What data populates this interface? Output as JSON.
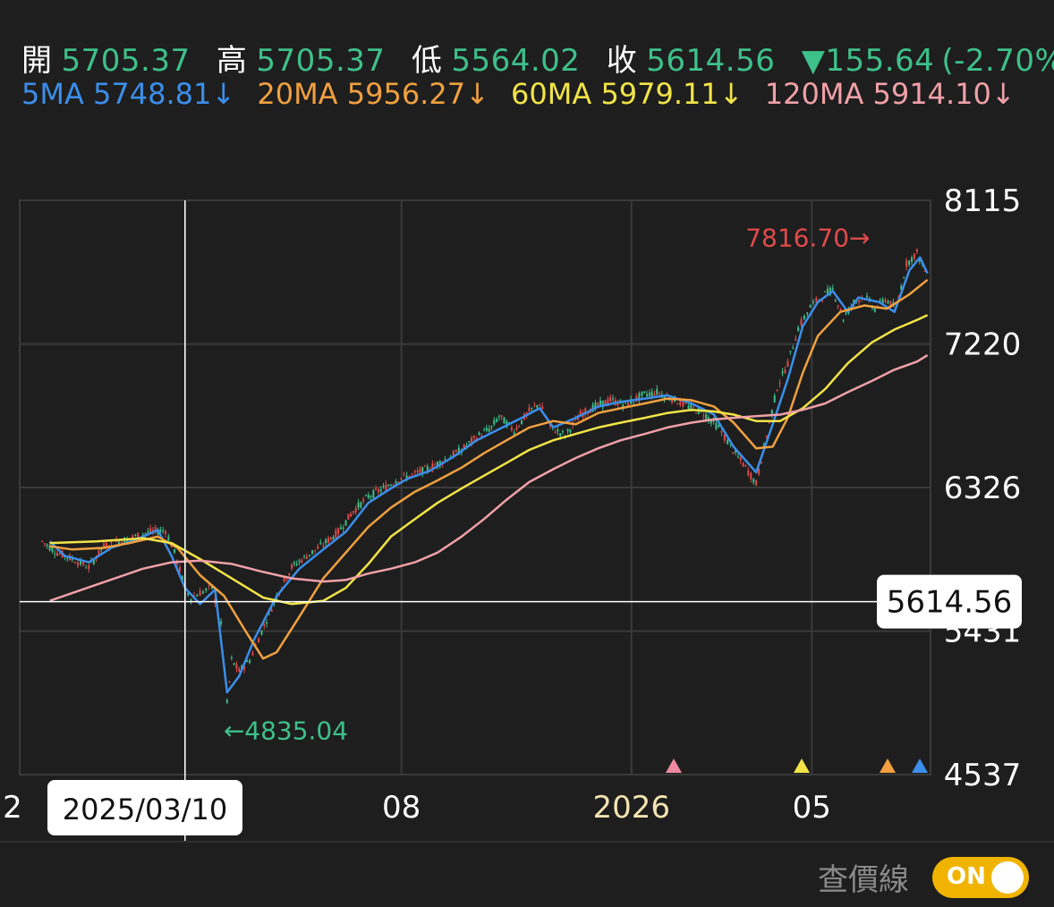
{
  "header": {
    "open_label": "開",
    "open": "5705.37",
    "high_label": "高",
    "high": "5705.37",
    "low_label": "低",
    "low": "5564.02",
    "close_label": "收",
    "close": "5614.56",
    "change": "▼155.64",
    "change_pct": "(-2.70%)"
  },
  "ma_legend": [
    {
      "text": "5MA 5748.81↓",
      "color": "#3b8eea"
    },
    {
      "text": "20MA 5956.27↓",
      "color": "#f0a040"
    },
    {
      "text": "60MA 5979.11↓",
      "color": "#f2e447"
    },
    {
      "text": "120MA 5914.10↓",
      "color": "#f0a0a8"
    }
  ],
  "toggle": {
    "label": "查價線",
    "state": "ON"
  },
  "colors": {
    "up": "#e04a4a",
    "down": "#3ec08a",
    "grid": "#3a3a3a",
    "ma5": "#3b8eea",
    "ma20": "#f0a040",
    "ma60": "#f2e447",
    "ma120": "#f0a0a8",
    "accent": "#f0b400"
  },
  "chart_data": {
    "type": "line",
    "y_ticks": [
      "8115",
      "7220",
      "6326",
      "5431",
      "4537"
    ],
    "ylim": [
      4537,
      8115
    ],
    "x_ticks": [
      {
        "label": "2",
        "date": "2024-12"
      },
      {
        "label": "2025/03/10",
        "date": "2025-03-10"
      },
      {
        "label": "08",
        "date": "2025-08"
      },
      {
        "label": "2026",
        "date": "2026-01"
      },
      {
        "label": "05",
        "date": "2026-05"
      }
    ],
    "crosshair": {
      "date": "2025/03/10",
      "price": "5614.56"
    },
    "annotations": [
      {
        "text": "7816.70",
        "kind": "high",
        "date": "2026-06-10",
        "value": 7816.7
      },
      {
        "text": "4835.04",
        "kind": "low",
        "date": "2025-04-07",
        "value": 4835.04
      }
    ],
    "series": [
      {
        "name": "5MA",
        "key": "ma5",
        "points": [
          [
            "2024-12-10",
            5990
          ],
          [
            "2024-12-20",
            5900
          ],
          [
            "2025-01-05",
            5860
          ],
          [
            "2025-01-20",
            5950
          ],
          [
            "2025-02-05",
            6000
          ],
          [
            "2025-02-20",
            6060
          ],
          [
            "2025-03-01",
            5900
          ],
          [
            "2025-03-10",
            5700
          ],
          [
            "2025-03-20",
            5600
          ],
          [
            "2025-03-30",
            5690
          ],
          [
            "2025-04-07",
            5050
          ],
          [
            "2025-04-15",
            5150
          ],
          [
            "2025-04-25",
            5380
          ],
          [
            "2025-05-10",
            5650
          ],
          [
            "2025-05-25",
            5820
          ],
          [
            "2025-06-10",
            5940
          ],
          [
            "2025-06-25",
            6050
          ],
          [
            "2025-07-10",
            6230
          ],
          [
            "2025-07-25",
            6320
          ],
          [
            "2025-08-05",
            6380
          ],
          [
            "2025-08-20",
            6430
          ],
          [
            "2025-09-05",
            6520
          ],
          [
            "2025-09-20",
            6620
          ],
          [
            "2025-10-05",
            6690
          ],
          [
            "2025-10-20",
            6760
          ],
          [
            "2025-11-01",
            6820
          ],
          [
            "2025-11-10",
            6700
          ],
          [
            "2025-11-25",
            6760
          ],
          [
            "2025-12-10",
            6830
          ],
          [
            "2025-12-25",
            6860
          ],
          [
            "2026-01-10",
            6880
          ],
          [
            "2026-01-25",
            6900
          ],
          [
            "2026-02-10",
            6850
          ],
          [
            "2026-02-25",
            6780
          ],
          [
            "2026-03-10",
            6580
          ],
          [
            "2026-03-25",
            6420
          ],
          [
            "2026-04-05",
            6720
          ],
          [
            "2026-04-15",
            7000
          ],
          [
            "2026-04-25",
            7330
          ],
          [
            "2026-05-05",
            7480
          ],
          [
            "2026-05-15",
            7550
          ],
          [
            "2026-05-25",
            7420
          ],
          [
            "2026-06-01",
            7510
          ],
          [
            "2026-06-15",
            7480
          ],
          [
            "2026-06-25",
            7420
          ],
          [
            "2026-07-05",
            7680
          ],
          [
            "2026-07-12",
            7760
          ],
          [
            "2026-07-17",
            7660
          ]
        ]
      },
      {
        "name": "20MA",
        "key": "ma20",
        "points": [
          [
            "2024-12-10",
            5960
          ],
          [
            "2024-12-25",
            5940
          ],
          [
            "2025-01-15",
            5950
          ],
          [
            "2025-02-01",
            5980
          ],
          [
            "2025-02-20",
            6020
          ],
          [
            "2025-03-05",
            5950
          ],
          [
            "2025-03-20",
            5780
          ],
          [
            "2025-04-05",
            5650
          ],
          [
            "2025-04-20",
            5420
          ],
          [
            "2025-05-01",
            5260
          ],
          [
            "2025-05-10",
            5300
          ],
          [
            "2025-05-25",
            5520
          ],
          [
            "2025-06-10",
            5760
          ],
          [
            "2025-06-25",
            5920
          ],
          [
            "2025-07-10",
            6080
          ],
          [
            "2025-07-25",
            6200
          ],
          [
            "2025-08-10",
            6300
          ],
          [
            "2025-08-25",
            6370
          ],
          [
            "2025-09-10",
            6450
          ],
          [
            "2025-09-25",
            6540
          ],
          [
            "2025-10-10",
            6620
          ],
          [
            "2025-10-25",
            6700
          ],
          [
            "2025-11-10",
            6740
          ],
          [
            "2025-11-25",
            6720
          ],
          [
            "2025-12-10",
            6790
          ],
          [
            "2025-12-25",
            6820
          ],
          [
            "2026-01-10",
            6850
          ],
          [
            "2026-01-25",
            6880
          ],
          [
            "2026-02-10",
            6870
          ],
          [
            "2026-02-25",
            6830
          ],
          [
            "2026-03-10",
            6730
          ],
          [
            "2026-03-25",
            6570
          ],
          [
            "2026-04-05",
            6580
          ],
          [
            "2026-04-15",
            6760
          ],
          [
            "2026-04-25",
            7040
          ],
          [
            "2026-05-05",
            7270
          ],
          [
            "2026-05-20",
            7420
          ],
          [
            "2026-06-05",
            7460
          ],
          [
            "2026-06-20",
            7440
          ],
          [
            "2026-07-05",
            7530
          ],
          [
            "2026-07-17",
            7620
          ]
        ]
      },
      {
        "name": "60MA",
        "key": "ma60",
        "points": [
          [
            "2024-12-10",
            5980
          ],
          [
            "2025-01-10",
            5990
          ],
          [
            "2025-02-10",
            6010
          ],
          [
            "2025-03-01",
            5980
          ],
          [
            "2025-03-20",
            5880
          ],
          [
            "2025-04-10",
            5760
          ],
          [
            "2025-05-01",
            5640
          ],
          [
            "2025-05-20",
            5600
          ],
          [
            "2025-06-10",
            5620
          ],
          [
            "2025-06-25",
            5700
          ],
          [
            "2025-07-10",
            5850
          ],
          [
            "2025-07-25",
            6020
          ],
          [
            "2025-08-10",
            6130
          ],
          [
            "2025-08-25",
            6230
          ],
          [
            "2025-09-10",
            6320
          ],
          [
            "2025-09-25",
            6400
          ],
          [
            "2025-10-10",
            6480
          ],
          [
            "2025-10-25",
            6560
          ],
          [
            "2025-11-10",
            6620
          ],
          [
            "2025-11-25",
            6660
          ],
          [
            "2025-12-10",
            6700
          ],
          [
            "2025-12-25",
            6730
          ],
          [
            "2026-01-10",
            6760
          ],
          [
            "2026-01-25",
            6790
          ],
          [
            "2026-02-10",
            6810
          ],
          [
            "2026-02-25",
            6800
          ],
          [
            "2026-03-10",
            6780
          ],
          [
            "2026-03-25",
            6740
          ],
          [
            "2026-04-10",
            6740
          ],
          [
            "2026-04-25",
            6820
          ],
          [
            "2026-05-10",
            6940
          ],
          [
            "2026-05-25",
            7100
          ],
          [
            "2026-06-10",
            7230
          ],
          [
            "2026-06-25",
            7310
          ],
          [
            "2026-07-10",
            7370
          ],
          [
            "2026-07-17",
            7400
          ]
        ]
      },
      {
        "name": "120MA",
        "key": "ma120",
        "points": [
          [
            "2024-12-10",
            5620
          ],
          [
            "2025-01-10",
            5720
          ],
          [
            "2025-02-10",
            5820
          ],
          [
            "2025-03-01",
            5860
          ],
          [
            "2025-03-20",
            5870
          ],
          [
            "2025-04-10",
            5850
          ],
          [
            "2025-05-01",
            5800
          ],
          [
            "2025-05-20",
            5760
          ],
          [
            "2025-06-10",
            5740
          ],
          [
            "2025-06-25",
            5750
          ],
          [
            "2025-07-10",
            5790
          ],
          [
            "2025-07-25",
            5820
          ],
          [
            "2025-08-10",
            5860
          ],
          [
            "2025-08-25",
            5920
          ],
          [
            "2025-09-10",
            6020
          ],
          [
            "2025-09-25",
            6130
          ],
          [
            "2025-10-10",
            6250
          ],
          [
            "2025-10-25",
            6360
          ],
          [
            "2025-11-10",
            6440
          ],
          [
            "2025-11-25",
            6510
          ],
          [
            "2025-12-10",
            6570
          ],
          [
            "2025-12-25",
            6620
          ],
          [
            "2026-01-10",
            6660
          ],
          [
            "2026-01-25",
            6700
          ],
          [
            "2026-02-10",
            6730
          ],
          [
            "2026-02-25",
            6750
          ],
          [
            "2026-03-10",
            6760
          ],
          [
            "2026-03-25",
            6770
          ],
          [
            "2026-04-10",
            6780
          ],
          [
            "2026-04-25",
            6810
          ],
          [
            "2026-05-10",
            6850
          ],
          [
            "2026-05-25",
            6920
          ],
          [
            "2026-06-10",
            6990
          ],
          [
            "2026-06-25",
            7060
          ],
          [
            "2026-07-10",
            7110
          ],
          [
            "2026-07-17",
            7150
          ]
        ]
      }
    ],
    "candles_close_path": [
      [
        "2024-12-05",
        5990
      ],
      [
        "2024-12-15",
        5920
      ],
      [
        "2024-12-25",
        5880
      ],
      [
        "2025-01-05",
        5830
      ],
      [
        "2025-01-15",
        5960
      ],
      [
        "2025-01-25",
        5990
      ],
      [
        "2025-02-05",
        6020
      ],
      [
        "2025-02-15",
        6050
      ],
      [
        "2025-02-25",
        6060
      ],
      [
        "2025-03-03",
        5920
      ],
      [
        "2025-03-10",
        5700
      ],
      [
        "2025-03-14",
        5640
      ],
      [
        "2025-03-20",
        5670
      ],
      [
        "2025-03-28",
        5700
      ],
      [
        "2025-04-03",
        5470
      ],
      [
        "2025-04-07",
        4980
      ],
      [
        "2025-04-10",
        5250
      ],
      [
        "2025-04-15",
        5180
      ],
      [
        "2025-04-22",
        5250
      ],
      [
        "2025-04-30",
        5430
      ],
      [
        "2025-05-10",
        5650
      ],
      [
        "2025-05-20",
        5830
      ],
      [
        "2025-05-30",
        5900
      ],
      [
        "2025-06-10",
        5970
      ],
      [
        "2025-06-20",
        6050
      ],
      [
        "2025-06-30",
        6180
      ],
      [
        "2025-07-10",
        6270
      ],
      [
        "2025-07-20",
        6320
      ],
      [
        "2025-07-30",
        6380
      ],
      [
        "2025-08-10",
        6410
      ],
      [
        "2025-08-20",
        6450
      ],
      [
        "2025-08-30",
        6500
      ],
      [
        "2025-09-10",
        6560
      ],
      [
        "2025-09-20",
        6640
      ],
      [
        "2025-09-30",
        6700
      ],
      [
        "2025-10-05",
        6770
      ],
      [
        "2025-10-15",
        6680
      ],
      [
        "2025-10-25",
        6800
      ],
      [
        "2025-11-01",
        6850
      ],
      [
        "2025-11-08",
        6700
      ],
      [
        "2025-11-18",
        6650
      ],
      [
        "2025-11-28",
        6780
      ],
      [
        "2025-12-08",
        6830
      ],
      [
        "2025-12-18",
        6870
      ],
      [
        "2025-12-28",
        6840
      ],
      [
        "2026-01-08",
        6900
      ],
      [
        "2026-01-18",
        6920
      ],
      [
        "2026-01-28",
        6880
      ],
      [
        "2026-02-08",
        6830
      ],
      [
        "2026-02-18",
        6790
      ],
      [
        "2026-02-28",
        6700
      ],
      [
        "2026-03-08",
        6580
      ],
      [
        "2026-03-18",
        6450
      ],
      [
        "2026-03-25",
        6350
      ],
      [
        "2026-04-01",
        6650
      ],
      [
        "2026-04-08",
        6950
      ],
      [
        "2026-04-15",
        7100
      ],
      [
        "2026-04-22",
        7320
      ],
      [
        "2026-04-30",
        7450
      ],
      [
        "2026-05-08",
        7520
      ],
      [
        "2026-05-15",
        7560
      ],
      [
        "2026-05-22",
        7380
      ],
      [
        "2026-05-29",
        7480
      ],
      [
        "2026-06-05",
        7520
      ],
      [
        "2026-06-12",
        7440
      ],
      [
        "2026-06-19",
        7500
      ],
      [
        "2026-06-26",
        7440
      ],
      [
        "2026-07-03",
        7720
      ],
      [
        "2026-07-10",
        7790
      ],
      [
        "2026-07-17",
        7640
      ]
    ]
  }
}
